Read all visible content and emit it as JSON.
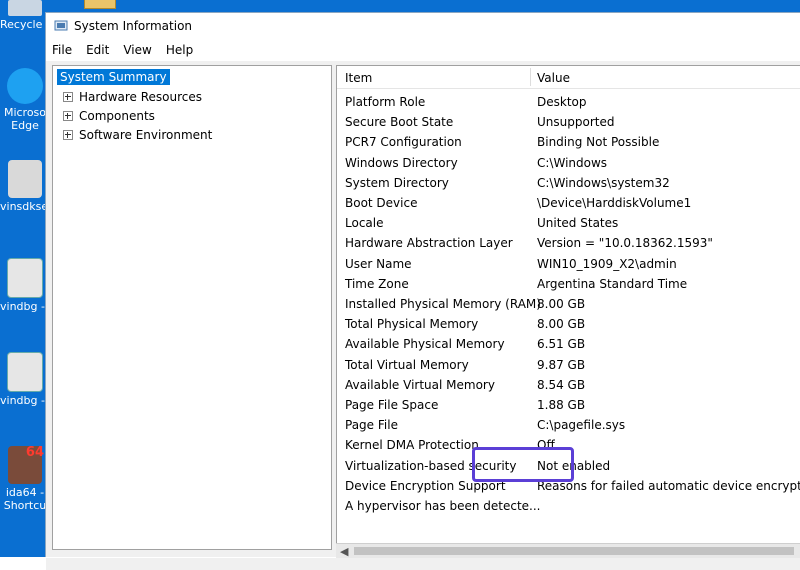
{
  "desktop": {
    "icons": [
      {
        "name": "recycle-bin",
        "label": "Recycle B"
      },
      {
        "name": "edge",
        "label_lines": [
          "Microso",
          "Edge"
        ]
      },
      {
        "name": "winsdksetup",
        "label": "vinsdkset"
      },
      {
        "name": "windbg-1",
        "label": "vindbg - >"
      },
      {
        "name": "windbg-2",
        "label": "vindbg - >"
      },
      {
        "name": "ida64",
        "label_lines": [
          "ida64 -",
          "Shortcu"
        ],
        "badge": "64"
      }
    ]
  },
  "window": {
    "title": "System Information",
    "menu": [
      "File",
      "Edit",
      "View",
      "Help"
    ]
  },
  "tree": {
    "selected": "System Summary",
    "children": [
      "Hardware Resources",
      "Components",
      "Software Environment"
    ]
  },
  "table": {
    "headers": {
      "item": "Item",
      "value": "Value"
    },
    "rows": [
      {
        "item": "Platform Role",
        "value": "Desktop"
      },
      {
        "item": "Secure Boot State",
        "value": "Unsupported"
      },
      {
        "item": "PCR7 Configuration",
        "value": "Binding Not Possible"
      },
      {
        "item": "Windows Directory",
        "value": "C:\\Windows"
      },
      {
        "item": "System Directory",
        "value": "C:\\Windows\\system32"
      },
      {
        "item": "Boot Device",
        "value": "\\Device\\HarddiskVolume1"
      },
      {
        "item": "Locale",
        "value": "United States"
      },
      {
        "item": "Hardware Abstraction Layer",
        "value": "Version = \"10.0.18362.1593\""
      },
      {
        "item": "User Name",
        "value": "WIN10_1909_X2\\admin"
      },
      {
        "item": "Time Zone",
        "value": "Argentina Standard Time"
      },
      {
        "item": "Installed Physical Memory (RAM)",
        "value": "8.00 GB"
      },
      {
        "item": "Total Physical Memory",
        "value": "8.00 GB"
      },
      {
        "item": "Available Physical Memory",
        "value": "6.51 GB"
      },
      {
        "item": "Total Virtual Memory",
        "value": "9.87 GB"
      },
      {
        "item": "Available Virtual Memory",
        "value": "8.54 GB"
      },
      {
        "item": "Page File Space",
        "value": "1.88 GB"
      },
      {
        "item": "Page File",
        "value": "C:\\pagefile.sys"
      },
      {
        "item": "Kernel DMA Protection",
        "value": "Off"
      },
      {
        "item": "Virtualization-based security",
        "value": "Not enabled"
      },
      {
        "item": "Device Encryption Support",
        "value": "Reasons for failed automatic device encryption"
      },
      {
        "item": "A hypervisor has been detecte...",
        "value": ""
      }
    ]
  },
  "colors": {
    "desktop": "#0a6fd1",
    "selection": "#0078d7",
    "annotation": "#5b3fd6"
  }
}
